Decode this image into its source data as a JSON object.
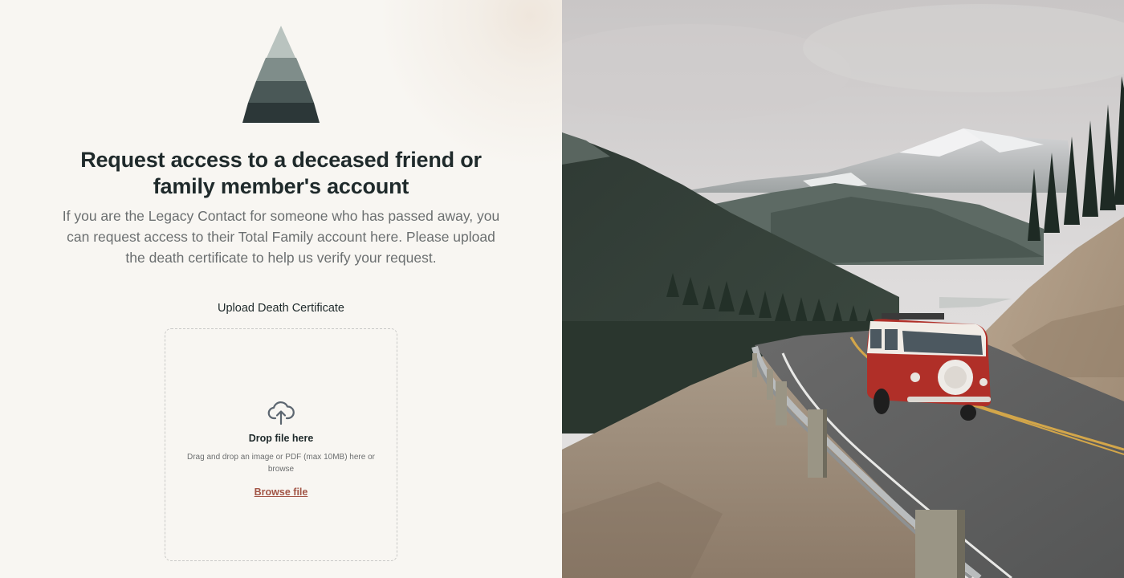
{
  "heading": "Request access to a deceased friend or family member's account",
  "description": "If you are the Legacy Contact for someone who has passed away, you can request access to their Total Family account here. Please upload the death certificate to help us verify your request.",
  "upload": {
    "label": "Upload Death Certificate",
    "drop_title": "Drop file here",
    "drop_hint": "Drag and drop an image or PDF (max 10MB) here or browse",
    "browse_link": "Browse file"
  },
  "icons": {
    "logo": "pine-tree-logo-icon",
    "upload": "cloud-upload-icon"
  },
  "colors": {
    "background": "#f8f6f2",
    "heading": "#1f2a2b",
    "body_text": "#6b6f70",
    "link": "#a25546",
    "tree_tier_1": "#b9c3bf",
    "tree_tier_2": "#7f8d8a",
    "tree_tier_3": "#4a5857",
    "tree_tier_4": "#2c3738"
  },
  "hero_image": {
    "subject": "red and white camper van on mountain road"
  }
}
